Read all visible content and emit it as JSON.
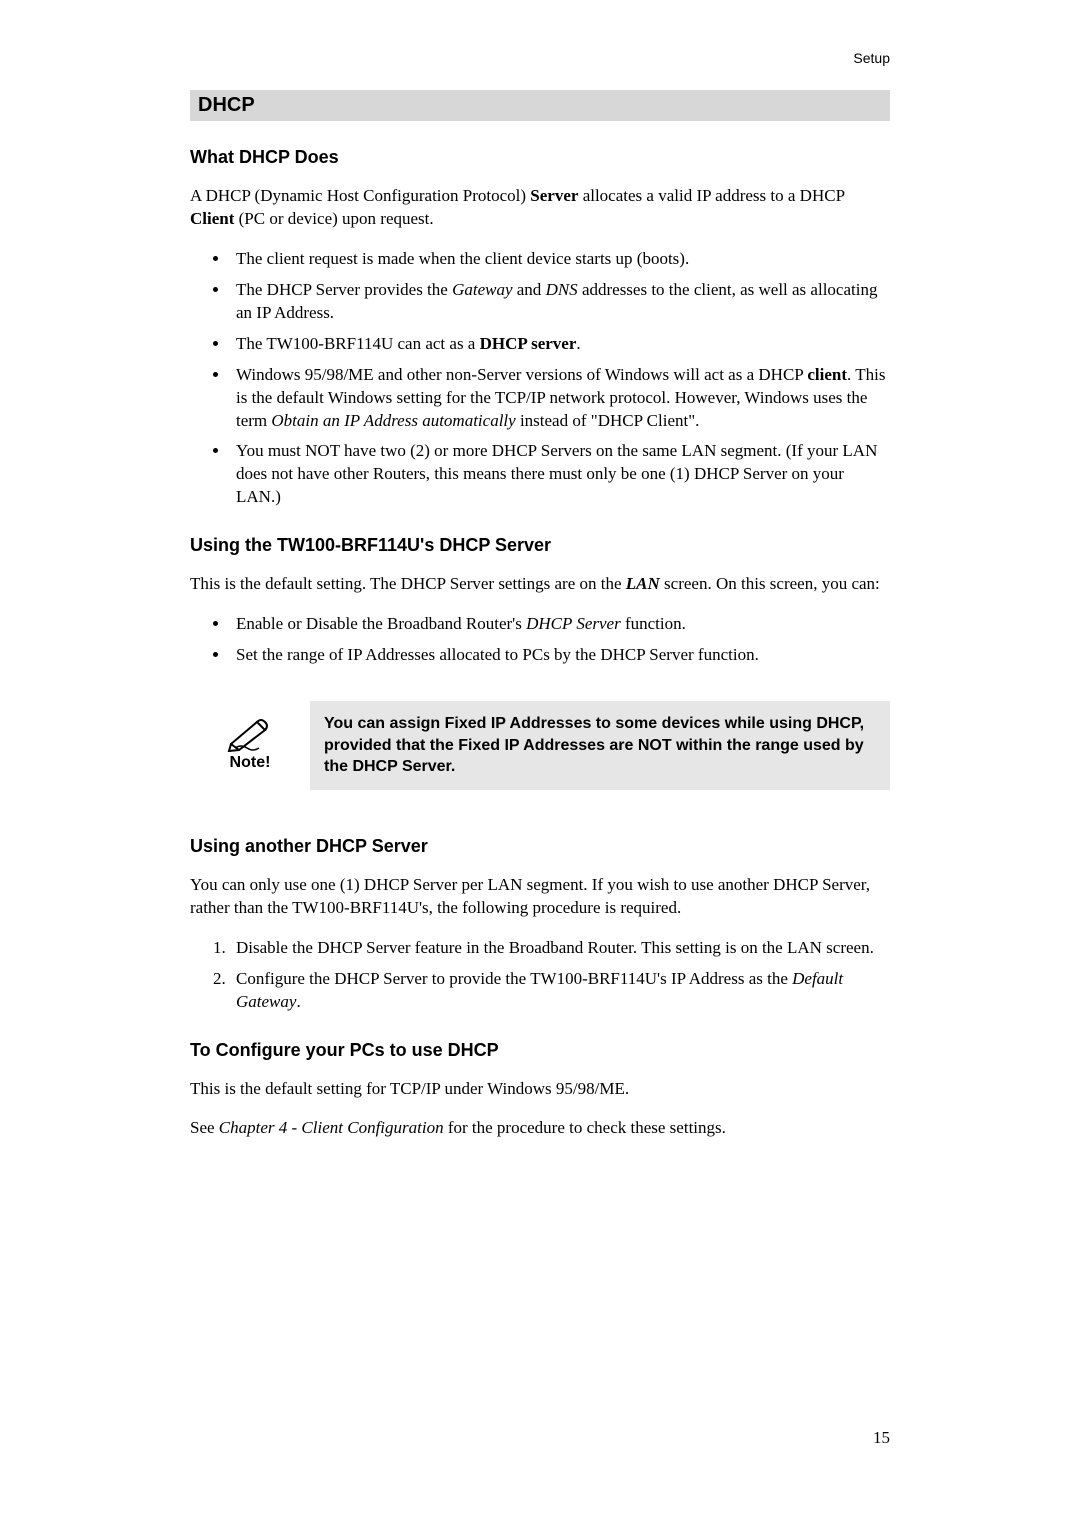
{
  "header": {
    "label": "Setup"
  },
  "section": {
    "title": "DHCP"
  },
  "h1": {
    "title": "What DHCP Does"
  },
  "p1": {
    "pre": "A DHCP (Dynamic Host Configuration Protocol) ",
    "b1": "Server",
    "mid": " allocates a valid IP address to a DHCP ",
    "b2": "Client",
    "post": " (PC or device) upon request."
  },
  "list1": {
    "i1": "The client request is made when the client device starts up (boots).",
    "i2": {
      "pre": "The DHCP Server provides the ",
      "it1": "Gateway",
      "mid": " and ",
      "it2": "DNS",
      "post": " addresses to the client, as well as allocating an IP Address."
    },
    "i3": {
      "pre": "The TW100-BRF114U can act as a ",
      "b1": "DHCP server",
      "post": "."
    },
    "i4": {
      "pre": "Windows 95/98/ME and other non-Server versions of Windows will act as a DHCP ",
      "b1": "client",
      "mid": ". This is the default Windows setting for the TCP/IP network protocol. However, Windows uses the term ",
      "it1": "Obtain an IP Address automatically",
      "post": " instead of \"DHCP Client\"."
    },
    "i5": "You must NOT have two (2) or more DHCP Servers on the same LAN segment. (If your LAN does not have other Routers, this means there must only be one (1) DHCP Server on your LAN.)"
  },
  "h2": {
    "title": "Using the TW100-BRF114U's DHCP Server"
  },
  "p2": {
    "pre": "This is the default setting. The DHCP Server settings are on the ",
    "b1": "LAN",
    "post": " screen. On this screen, you can:"
  },
  "list2": {
    "i1": {
      "pre": "Enable or Disable the Broadband Router's ",
      "it1": "DHCP Server",
      "post": " function."
    },
    "i2": "Set the range of IP Addresses allocated to PCs by the DHCP Server function."
  },
  "note": {
    "label": "Note!",
    "text": "You can assign Fixed IP Addresses to some devices while using DHCP, provided that the Fixed IP Addresses are NOT within the range used by the DHCP Server."
  },
  "h3": {
    "title": "Using another DHCP Server"
  },
  "p3": "You can only use one (1) DHCP Server per LAN segment. If you wish to use another DHCP Server, rather than the TW100-BRF114U's, the following procedure is required.",
  "list3": {
    "i1": "Disable the DHCP Server feature in the Broadband Router. This setting is on the LAN screen.",
    "i2": {
      "pre": "Configure the DHCP Server to provide the TW100-BRF114U's IP Address as the ",
      "it1": "Default Gateway",
      "post": "."
    }
  },
  "h4": {
    "title": "To Configure your PCs to use DHCP"
  },
  "p4": "This is the default setting for TCP/IP under Windows 95/98/ME.",
  "p5": {
    "pre": "See ",
    "it1": "Chapter 4 - Client Configuration",
    "post": " for the procedure to check these settings."
  },
  "pageNumber": "15"
}
